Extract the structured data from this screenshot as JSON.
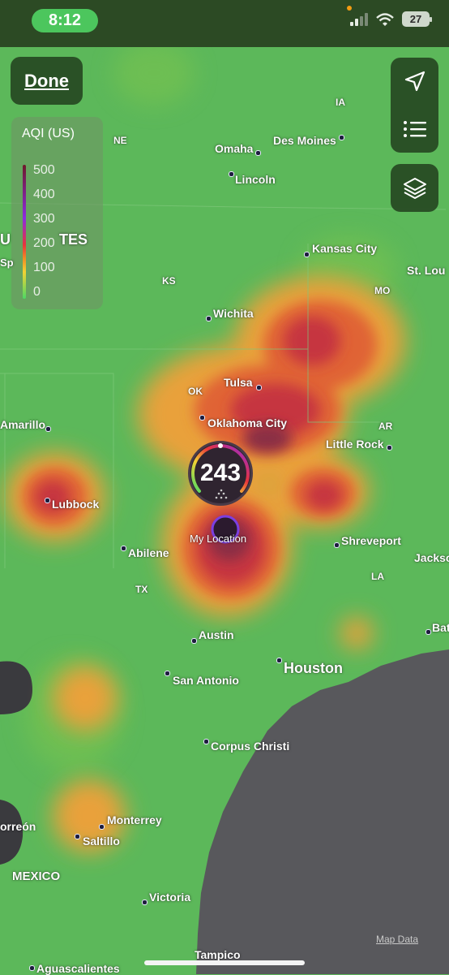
{
  "status_bar": {
    "time": "8:12",
    "battery": "27",
    "icons": [
      "signal-icon",
      "wifi-icon",
      "battery-icon"
    ]
  },
  "controls": {
    "done_label": "Done",
    "location_icon": "location-arrow-icon",
    "list_icon": "list-icon",
    "layers_icon": "layers-icon"
  },
  "legend": {
    "title": "AQI (US)",
    "labels": [
      "500",
      "400",
      "300",
      "200",
      "100",
      "0"
    ]
  },
  "aqi_marker": {
    "value": "243",
    "location_label": "My Location",
    "icon": "aqi-particles-icon"
  },
  "cities": {
    "omaha": "Omaha",
    "des_moines": "Des Moines",
    "lincoln": "Lincoln",
    "kansas_city": "Kansas City",
    "st_louis": "St. Lou",
    "wichita": "Wichita",
    "tulsa": "Tulsa",
    "oklahoma_city": "Oklahoma City",
    "little_rock": "Little Rock",
    "amarillo": "Amarillo",
    "lubbock": "Lubbock",
    "abilene": "Abilene",
    "shreveport": "Shreveport",
    "jackson": "Jackso",
    "austin": "Austin",
    "houston": "Houston",
    "san_antonio": "San Antonio",
    "bat": "Bat",
    "corpus_christi": "Corpus Christi",
    "monterrey": "Monterrey",
    "saltillo": "Saltillo",
    "torreon": "orreón",
    "victoria": "Victoria",
    "tampico": "Tampico",
    "aguascalientes": "Aguascalientes",
    "sp": "Sp"
  },
  "states": {
    "ia": "IA",
    "ne": "NE",
    "ks": "KS",
    "mo": "MO",
    "ok": "OK",
    "ar": "AR",
    "tx": "TX",
    "la": "LA"
  },
  "countries": {
    "united_states": "U            TES",
    "mexico": "MEXICO"
  },
  "map_data_label": "Map Data",
  "colors": {
    "status_bar": "#2c4a24",
    "time_pill": "#4cc65d",
    "panel": "#264822",
    "land": "#5cb85a",
    "water": "#58585c"
  }
}
